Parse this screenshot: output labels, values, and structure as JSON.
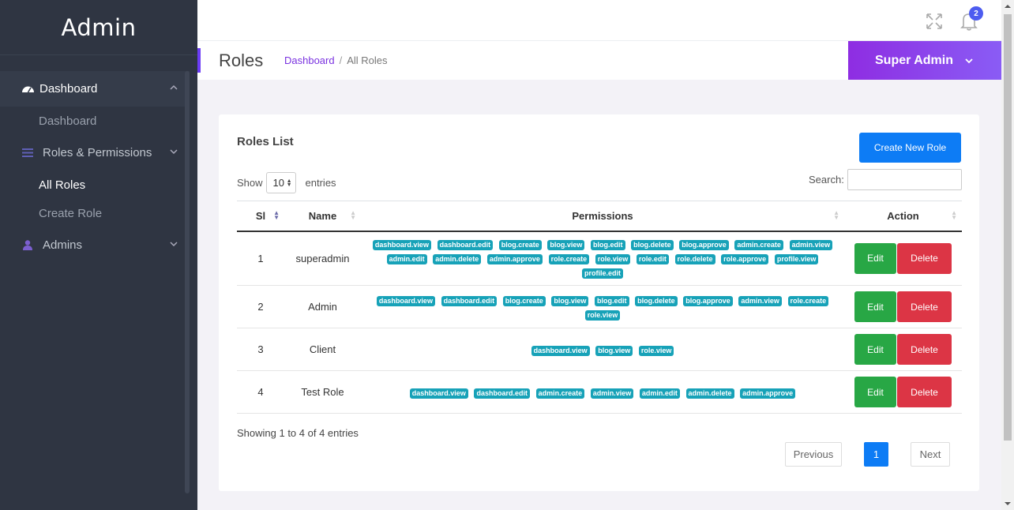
{
  "sidebar": {
    "brand": "Admin",
    "menu": [
      {
        "label": "Dashboard",
        "icon": "dashboard-gauge-icon",
        "children": [
          "Dashboard"
        ]
      },
      {
        "label": "Roles & Permissions",
        "icon": "list-icon",
        "children": [
          "All Roles",
          "Create Role"
        ]
      },
      {
        "label": "Admins",
        "icon": "user-icon"
      }
    ]
  },
  "topbar": {
    "notification_count": "2"
  },
  "page": {
    "title": "Roles",
    "breadcrumb": {
      "home": "Dashboard",
      "separator": "/",
      "current": "All Roles"
    },
    "user": "Super Admin"
  },
  "card": {
    "title": "Roles List",
    "create_button": "Create New Role",
    "show_label": "Show",
    "show_value": "10",
    "entries_label": "entries",
    "search_label": "Search:"
  },
  "table": {
    "headers": [
      "Sl",
      "Name",
      "Permissions",
      "Action"
    ],
    "edit_label": "Edit",
    "delete_label": "Delete",
    "rows": [
      {
        "sl": "1",
        "name": "superadmin",
        "permissions": [
          "dashboard.view",
          "dashboard.edit",
          "blog.create",
          "blog.view",
          "blog.edit",
          "blog.delete",
          "blog.approve",
          "admin.create",
          "admin.view",
          "admin.edit",
          "admin.delete",
          "admin.approve",
          "role.create",
          "role.view",
          "role.edit",
          "role.delete",
          "role.approve",
          "profile.view",
          "profile.edit"
        ]
      },
      {
        "sl": "2",
        "name": "Admin",
        "permissions": [
          "dashboard.view",
          "dashboard.edit",
          "blog.create",
          "blog.view",
          "blog.edit",
          "blog.delete",
          "blog.approve",
          "admin.view",
          "role.create",
          "role.view"
        ]
      },
      {
        "sl": "3",
        "name": "Client",
        "permissions": [
          "dashboard.view",
          "blog.view",
          "role.view"
        ]
      },
      {
        "sl": "4",
        "name": "Test Role",
        "permissions": [
          "dashboard.view",
          "dashboard.edit",
          "admin.create",
          "admin.view",
          "admin.edit",
          "admin.delete",
          "admin.approve"
        ]
      }
    ]
  },
  "footer": {
    "info": "Showing 1 to 4 of 4 entries",
    "previous": "Previous",
    "page": "1",
    "next": "Next"
  },
  "colors": {
    "sidebar": "#2f3542",
    "accent": "#8e2de2",
    "primary": "#0d7cf5",
    "success": "#28a745",
    "danger": "#dc3545",
    "tag": "#17a2b8"
  }
}
